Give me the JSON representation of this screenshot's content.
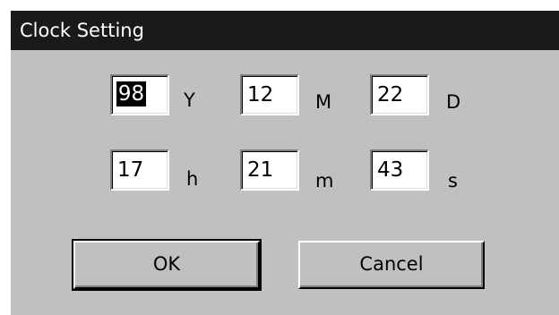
{
  "window": {
    "title": "Clock Setting"
  },
  "date": {
    "year": "98",
    "year_unit": "Y",
    "month": "12",
    "month_unit": "M",
    "day": "22",
    "day_unit": "D"
  },
  "time": {
    "hour": "17",
    "hour_unit": "h",
    "minute": "21",
    "minute_unit": "m",
    "second": "43",
    "second_unit": "s"
  },
  "buttons": {
    "ok_label": "OK",
    "cancel_label": "Cancel"
  }
}
